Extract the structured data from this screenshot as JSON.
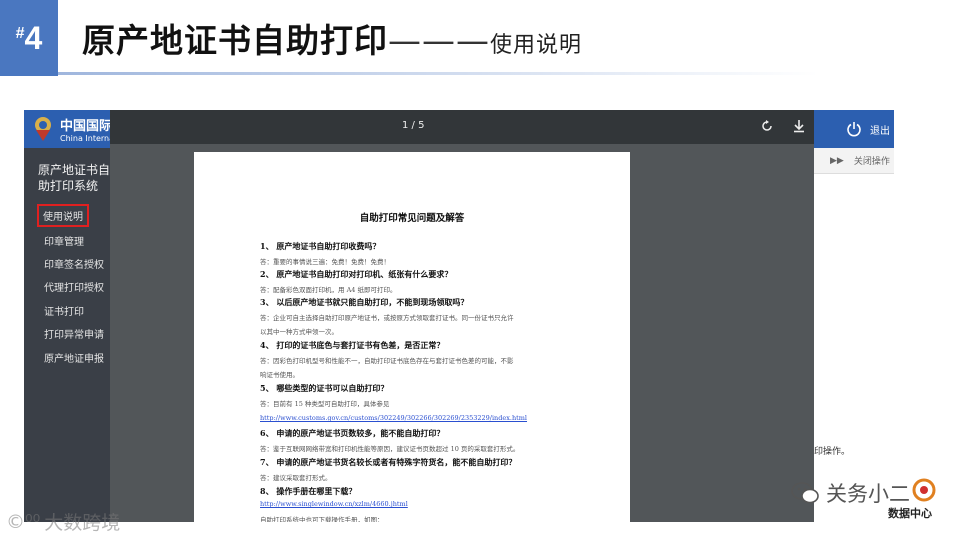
{
  "slide": {
    "hash": "#",
    "number": "4",
    "title": "原产地证书自助打印",
    "dash": "———",
    "subtitle": "使用说明"
  },
  "app": {
    "brand_cn": "中国国际",
    "brand_en": "China Internatio",
    "logout_label": "退出",
    "close_ops_label": "关闭操作",
    "right_text": "印操作。",
    "sidebar": {
      "title": "原产地证书自助打印系统",
      "items": [
        {
          "label": "使用说明",
          "active": true
        },
        {
          "label": "印章管理"
        },
        {
          "label": "印章签名授权"
        },
        {
          "label": "代理打印授权"
        },
        {
          "label": "证书打印"
        },
        {
          "label": "打印异常申请"
        },
        {
          "label": "原产地证申报"
        }
      ]
    }
  },
  "pdf": {
    "page_indicator": "1 / 5",
    "title": "自助打印常见问题及解答",
    "qa": [
      {
        "q": "1、 原产地证书自助打印收费吗？",
        "a": [
          "答：重要的事情说三遍：免费！免费！免费！"
        ]
      },
      {
        "q": "2、 原产地证书自助打印对打印机、纸张有什么要求？",
        "a": [
          "答：配备彩色双面打印机，用 A4 纸即可打印。"
        ]
      },
      {
        "q": "3、 以后原产地证书就只能自助打印，不能到现场领取吗？",
        "a": [
          "答：企业可自主选择自助打印原产地证书，或按原方式领取套打证书。同一份证书只允许",
          "以其中一种方式申领一次。"
        ]
      },
      {
        "q": "4、 打印的证书底色与套打证书有色差，是否正常？",
        "a": [
          "答：因彩色打印机型号和性能不一，自助打印证书底色存在与套打证书色差的可能，不影",
          "响证书使用。"
        ]
      },
      {
        "q": "5、 哪些类型的证书可以自助打印？",
        "a": [
          "答：目前有 15 种类型可自助打印，具体参见"
        ],
        "link": "http://www.customs.gov.cn/customs/302249/302266/302269/2353229/index.html"
      },
      {
        "q": "6、 申请的原产地证书页数较多，能不能自助打印？",
        "a": [
          "答：鉴于互联网网络带宽和打印机性能等原因，建议证书页数超过 10 页的采取套打形式。"
        ]
      },
      {
        "q": "7、 申请的原产地证书货名较长或者有特殊字符货名，能不能自助打印？",
        "a": [
          "答：建议采取套打形式。"
        ]
      },
      {
        "q": "8、 操作手册在哪里下载？",
        "a": [],
        "link": "http://www.singlewindow.cn/xzlm/4660.jhtml",
        "after": "自助打印系统中也可下载操作手册，如图："
      }
    ]
  },
  "watermarks": {
    "left": "大数跨境",
    "right": "关务小二",
    "badge": "数据中心"
  }
}
